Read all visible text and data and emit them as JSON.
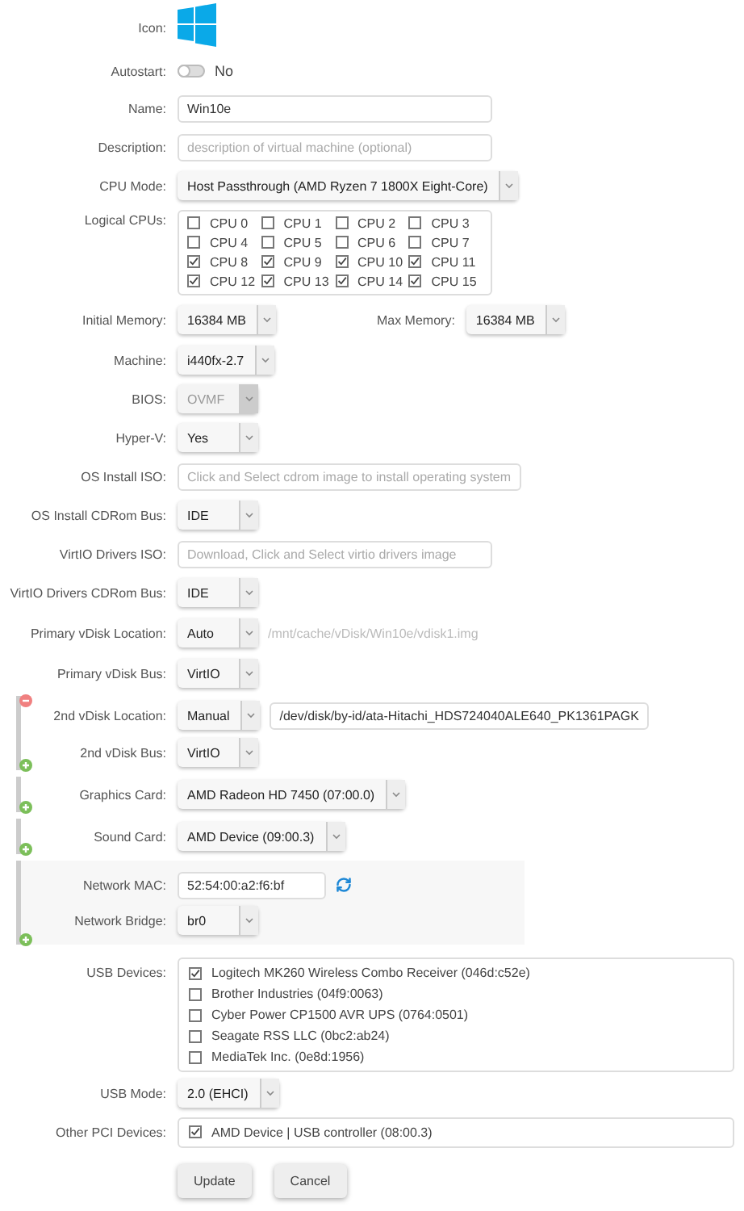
{
  "rows": [
    {
      "kind": "icon",
      "label": "Icon:"
    },
    {
      "kind": "toggle",
      "label": "Autostart:",
      "on": false,
      "state_text": "No"
    },
    {
      "kind": "text",
      "label": "Name:",
      "value": "Win10e"
    },
    {
      "kind": "text",
      "label": "Description:",
      "placeholder": "description of virtual machine (optional)"
    },
    {
      "kind": "select",
      "label": "CPU Mode:",
      "value": "Host Passthrough (AMD Ryzen 7 1800X Eight-Core)",
      "disabled": false
    },
    {
      "kind": "checkgrid",
      "label": "Logical CPUs:",
      "options": [
        {
          "label": "CPU 0",
          "checked": false
        },
        {
          "label": "CPU 1",
          "checked": false
        },
        {
          "label": "CPU 2",
          "checked": false
        },
        {
          "label": "CPU 3",
          "checked": false
        },
        {
          "label": "CPU 4",
          "checked": false
        },
        {
          "label": "CPU 5",
          "checked": false
        },
        {
          "label": "CPU 6",
          "checked": false
        },
        {
          "label": "CPU 7",
          "checked": false
        },
        {
          "label": "CPU 8",
          "checked": true
        },
        {
          "label": "CPU 9",
          "checked": true
        },
        {
          "label": "CPU 10",
          "checked": true
        },
        {
          "label": "CPU 11",
          "checked": true
        },
        {
          "label": "CPU 12",
          "checked": true
        },
        {
          "label": "CPU 13",
          "checked": true
        },
        {
          "label": "CPU 14",
          "checked": true
        },
        {
          "label": "CPU 15",
          "checked": true
        }
      ]
    },
    {
      "kind": "memory",
      "label": "Initial Memory:",
      "value": "16384 MB",
      "max_label": "Max Memory:",
      "max_value": "16384 MB"
    },
    {
      "kind": "select",
      "label": "Machine:",
      "value": "i440fx-2.7",
      "disabled": false
    },
    {
      "kind": "select",
      "label": "BIOS:",
      "value": "OVMF",
      "disabled": true
    },
    {
      "kind": "select",
      "label": "Hyper-V:",
      "value": "Yes",
      "disabled": false
    },
    {
      "kind": "text",
      "label": "OS Install ISO:",
      "placeholder": "Click and Select cdrom image to install operating system"
    },
    {
      "kind": "select",
      "label": "OS Install CDRom Bus:",
      "value": "IDE",
      "disabled": false
    },
    {
      "kind": "text",
      "label": "VirtIO Drivers ISO:",
      "placeholder": "Download, Click and Select virtio drivers image"
    },
    {
      "kind": "select",
      "label": "VirtIO Drivers CDRom Bus:",
      "value": "IDE",
      "disabled": false
    },
    {
      "kind": "select",
      "label": "Primary vDisk Location:",
      "value": "Auto",
      "disabled": false,
      "note": "/mnt/cache/vDisk/Win10e/vdisk1.img"
    },
    {
      "kind": "select",
      "label": "Primary vDisk Bus:",
      "value": "VirtIO",
      "disabled": false
    },
    {
      "kind": "group",
      "shaded": false,
      "removable": true,
      "rows": [
        {
          "kind": "select",
          "label": "2nd vDisk Location:",
          "value": "Manual",
          "disabled": false,
          "input_value": "/dev/disk/by-id/ata-Hitachi_HDS724040ALE640_PK1361PAGK"
        },
        {
          "kind": "select",
          "label": "2nd vDisk Bus:",
          "value": "VirtIO",
          "disabled": false
        }
      ]
    },
    {
      "kind": "group",
      "shaded": false,
      "removable": false,
      "rows": [
        {
          "kind": "select",
          "label": "Graphics Card:",
          "value": "AMD Radeon HD 7450 (07:00.0)",
          "disabled": false
        }
      ]
    },
    {
      "kind": "group",
      "shaded": false,
      "removable": false,
      "rows": [
        {
          "kind": "select",
          "label": "Sound Card:",
          "value": "AMD Device (09:00.3)",
          "disabled": false
        }
      ]
    },
    {
      "kind": "group",
      "shaded": true,
      "removable": false,
      "rows": [
        {
          "kind": "mac",
          "label": "Network MAC:",
          "value": "52:54:00:a2:f6:bf"
        },
        {
          "kind": "select",
          "label": "Network Bridge:",
          "value": "br0",
          "disabled": false
        }
      ]
    },
    {
      "kind": "checklist",
      "label": "USB Devices:",
      "options": [
        {
          "label": "Logitech MK260 Wireless Combo Receiver (046d:c52e)",
          "checked": true
        },
        {
          "label": "Brother Industries (04f9:0063)",
          "checked": false
        },
        {
          "label": "Cyber Power CP1500 AVR UPS (0764:0501)",
          "checked": false
        },
        {
          "label": "Seagate RSS LLC (0bc2:ab24)",
          "checked": false
        },
        {
          "label": "MediaTek Inc. (0e8d:1956)",
          "checked": false
        }
      ]
    },
    {
      "kind": "select",
      "label": "USB Mode:",
      "value": "2.0 (EHCI)",
      "disabled": false
    },
    {
      "kind": "checklist",
      "label": "Other PCI Devices:",
      "options": [
        {
          "label": "AMD Device | USB controller (08:00.3)",
          "checked": true
        }
      ]
    }
  ],
  "buttons": [
    {
      "label": "Update"
    },
    {
      "label": "Cancel"
    }
  ]
}
